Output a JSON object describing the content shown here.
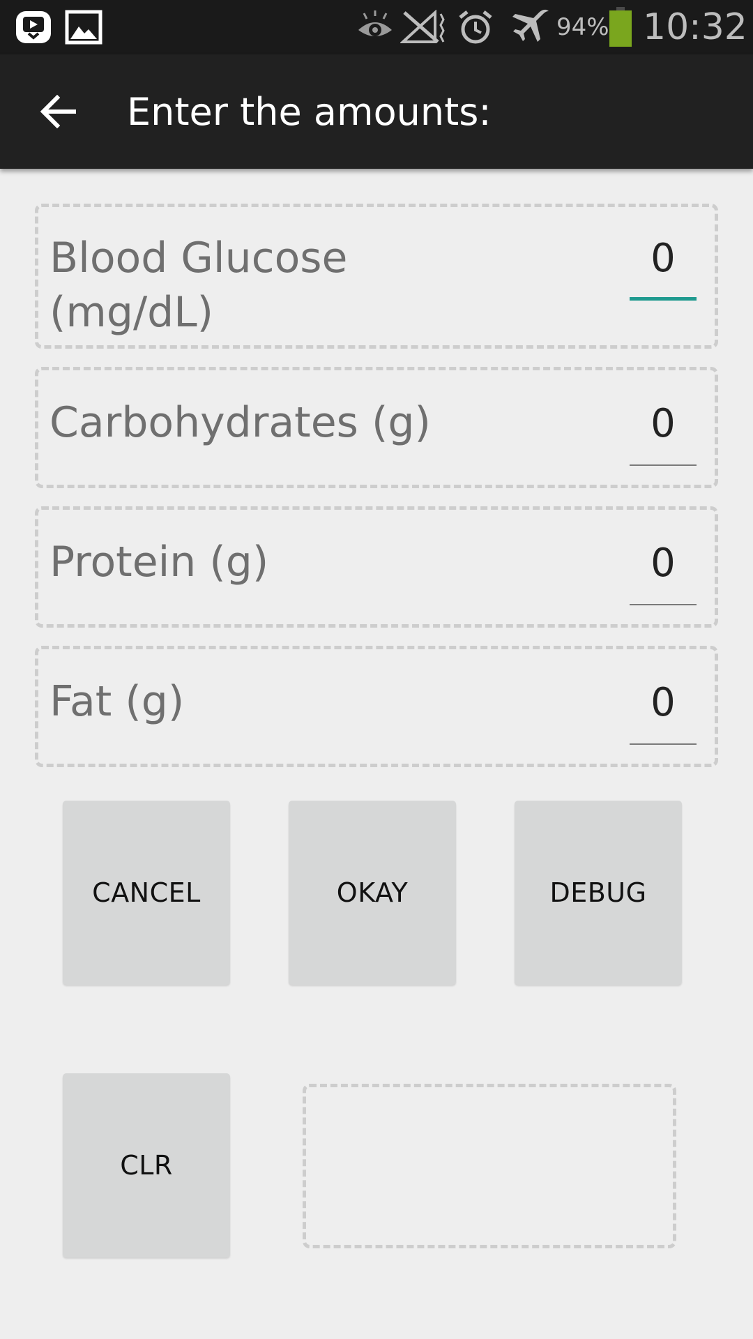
{
  "status_bar": {
    "battery_percent": "94%",
    "time": "10:32",
    "icons": [
      "cast-notification-icon",
      "image-notification-icon",
      "eye-icon",
      "no-signal-icon",
      "alarm-icon",
      "airplane-mode-icon",
      "battery-icon"
    ],
    "battery_color": "#7aa61e"
  },
  "app_bar": {
    "title": "Enter the amounts:",
    "back_icon": "arrow-left-icon"
  },
  "fields": [
    {
      "label": "Blood Glucose (mg/dL)",
      "value": "0"
    },
    {
      "label": "Carbohydrates (g)",
      "value": "0"
    },
    {
      "label": "Protein (g)",
      "value": "0"
    },
    {
      "label": "Fat (g)",
      "value": "0"
    }
  ],
  "buttons": {
    "cancel": "CANCEL",
    "okay": "OKAY",
    "debug": "DEBUG",
    "clear": "CLR"
  },
  "colors": {
    "accent": "#1f9a8f",
    "app_bar": "#212121",
    "background": "#eeeeee",
    "button": "#d6d7d7"
  }
}
